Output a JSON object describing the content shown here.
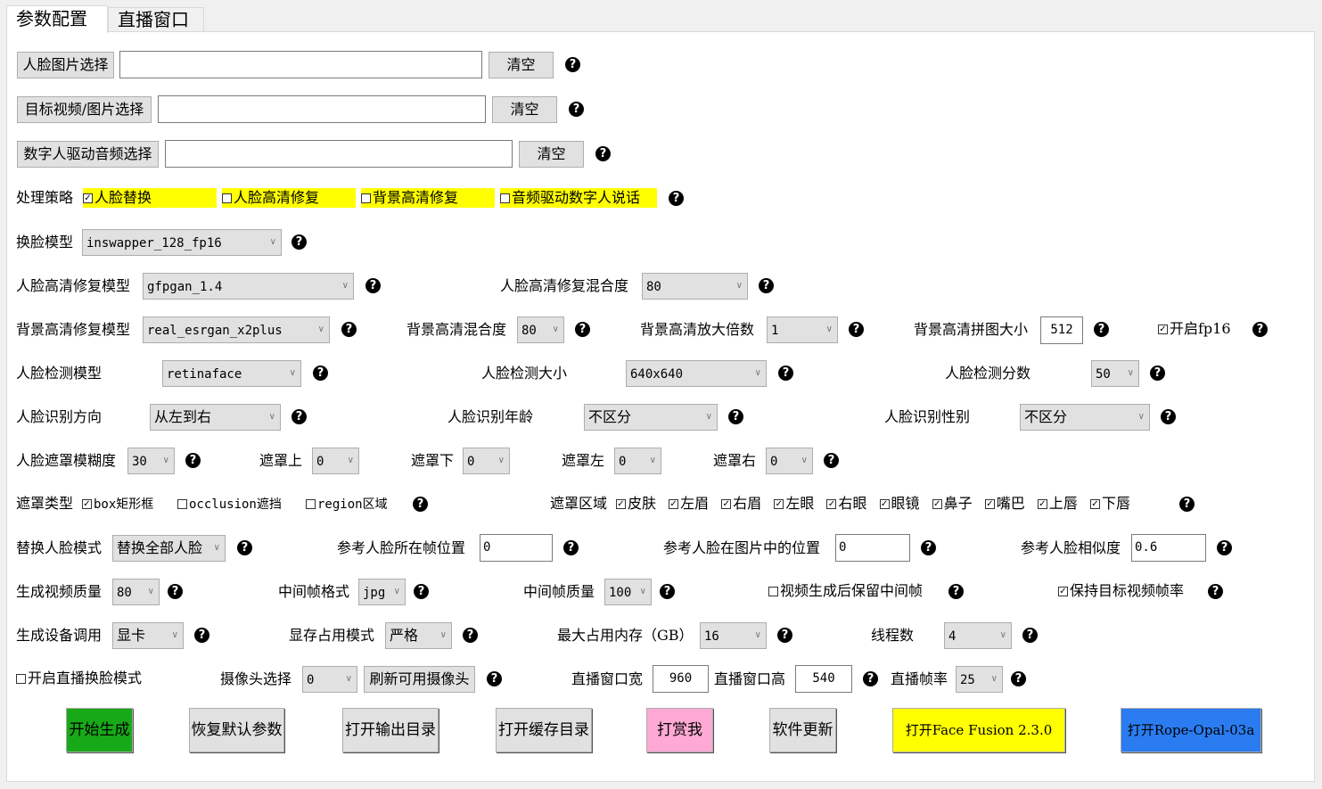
{
  "tabs": [
    {
      "label": "参数配置",
      "active": true
    },
    {
      "label": "直播窗口",
      "active": false
    }
  ],
  "file_rows": [
    {
      "button": "人脸图片选择",
      "value": "",
      "clear": "清空"
    },
    {
      "button": "目标视频/图片选择",
      "value": "",
      "clear": "清空"
    },
    {
      "button": "数字人驱动音频选择",
      "value": "",
      "clear": "清空"
    }
  ],
  "help_glyph": "?",
  "strategy": {
    "label": "处理策略",
    "options": [
      {
        "label": "人脸替换",
        "checked": true
      },
      {
        "label": "人脸高清修复",
        "checked": false
      },
      {
        "label": "背景高清修复",
        "checked": false
      },
      {
        "label": "音频驱动数字人说话",
        "checked": false
      }
    ],
    "highlight_color": "#ffff00"
  },
  "swap_model": {
    "label": "换脸模型",
    "value": "inswapper_128_fp16"
  },
  "face_enhance": {
    "model_label": "人脸高清修复模型",
    "model_value": "gfpgan_1.4",
    "blend_label": "人脸高清修复混合度",
    "blend_value": "80"
  },
  "bg_enhance": {
    "model_label": "背景高清修复模型",
    "model_value": "real_esrgan_x2plus",
    "blend_label": "背景高清混合度",
    "blend_value": "80",
    "scale_label": "背景高清放大倍数",
    "scale_value": "1",
    "tile_label": "背景高清拼图大小",
    "tile_value": "512",
    "fp16_label": "开启fp16",
    "fp16_checked": true
  },
  "detect": {
    "model_label": "人脸检测模型",
    "model_value": "retinaface",
    "size_label": "人脸检测大小",
    "size_value": "640x640",
    "score_label": "人脸检测分数",
    "score_value": "50"
  },
  "recognize": {
    "direction_label": "人脸识别方向",
    "direction_value": "从左到右",
    "age_label": "人脸识别年龄",
    "age_value": "不区分",
    "gender_label": "人脸识别性别",
    "gender_value": "不区分"
  },
  "mask": {
    "blur_label": "人脸遮罩模糊度",
    "blur_value": "30",
    "top_label": "遮罩上",
    "top_value": "0",
    "bottom_label": "遮罩下",
    "bottom_value": "0",
    "left_label": "遮罩左",
    "left_value": "0",
    "right_label": "遮罩右",
    "right_value": "0"
  },
  "mask_type": {
    "label": "遮罩类型",
    "options": [
      {
        "label": "box矩形框",
        "checked": true
      },
      {
        "label": "occlusion遮挡",
        "checked": false
      },
      {
        "label": "region区域",
        "checked": false
      }
    ]
  },
  "mask_region": {
    "label": "遮罩区域",
    "options": [
      {
        "label": "皮肤",
        "checked": true
      },
      {
        "label": "左眉",
        "checked": true
      },
      {
        "label": "右眉",
        "checked": true
      },
      {
        "label": "左眼",
        "checked": true
      },
      {
        "label": "右眼",
        "checked": true
      },
      {
        "label": "眼镜",
        "checked": true
      },
      {
        "label": "鼻子",
        "checked": true
      },
      {
        "label": "嘴巴",
        "checked": true
      },
      {
        "label": "上唇",
        "checked": true
      },
      {
        "label": "下唇",
        "checked": true
      }
    ]
  },
  "reference": {
    "mode_label": "替换人脸模式",
    "mode_value": "替换全部人脸",
    "frame_label": "参考人脸所在帧位置",
    "frame_value": "0",
    "position_label": "参考人脸在图片中的位置",
    "position_value": "0",
    "similarity_label": "参考人脸相似度",
    "similarity_value": "0.6"
  },
  "output": {
    "quality_label": "生成视频质量",
    "quality_value": "80",
    "frame_format_label": "中间帧格式",
    "frame_format_value": "jpg",
    "frame_quality_label": "中间帧质量",
    "frame_quality_value": "100",
    "keep_frames_label": "视频生成后保留中间帧",
    "keep_frames_checked": false,
    "keep_fps_label": "保持目标视频帧率",
    "keep_fps_checked": true
  },
  "device": {
    "device_label": "生成设备调用",
    "device_value": "显卡",
    "vram_label": "显存占用模式",
    "vram_value": "严格",
    "mem_label": "最大占用内存（GB）",
    "mem_value": "16",
    "threads_label": "线程数",
    "threads_value": "4"
  },
  "live": {
    "enable_label": "开启直播换脸模式",
    "enable_checked": false,
    "camera_label": "摄像头选择",
    "camera_value": "0",
    "refresh_label": "刷新可用摄像头",
    "width_label": "直播窗口宽",
    "width_value": "960",
    "height_label": "直播窗口高",
    "height_value": "540",
    "fps_label": "直播帧率",
    "fps_value": "25"
  },
  "actions": [
    {
      "label": "开始生成",
      "color": "#18a918"
    },
    {
      "label": "恢复默认参数",
      "color": "#e1e1e1"
    },
    {
      "label": "打开输出目录",
      "color": "#e1e1e1"
    },
    {
      "label": "打开缓存目录",
      "color": "#e1e1e1"
    },
    {
      "label": "打赏我",
      "color": "#ffaad4"
    },
    {
      "label": "软件更新",
      "color": "#e1e1e1"
    },
    {
      "label": "打开Face Fusion 2.3.0",
      "color": "#ffff00"
    },
    {
      "label": "打开Rope-Opal-03a",
      "color": "#2a7cf0"
    }
  ]
}
